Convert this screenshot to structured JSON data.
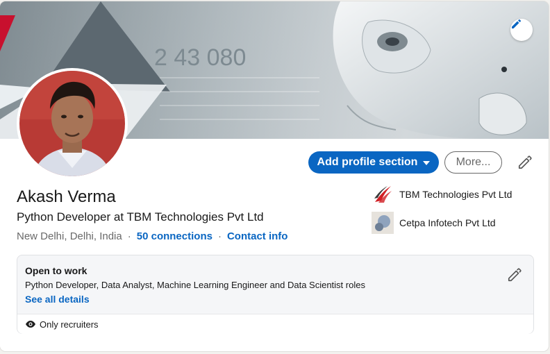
{
  "profile": {
    "name": "Akash Verma",
    "headline": "Python Developer at TBM Technologies Pvt Ltd",
    "location": "New Delhi, Delhi, India",
    "connections": "50 connections",
    "contact_info": "Contact info",
    "separator": "·"
  },
  "banner": {
    "overlay_text": "2 43 080",
    "edit_icon": "pencil-icon"
  },
  "actions": {
    "add_section_label": "Add profile section",
    "more_label": "More...",
    "edit_icon": "pencil-icon"
  },
  "companies": [
    {
      "name": "TBM Technologies Pvt Ltd",
      "logo": "tbm-logo"
    },
    {
      "name": "Cetpa Infotech Pvt Ltd",
      "logo": "cetpa-logo"
    }
  ],
  "open_to_work": {
    "title": "Open to work",
    "roles": "Python Developer, Data Analyst, Machine Learning Engineer and Data Scientist roles",
    "details_link": "See all details",
    "visibility": "Only recruiters",
    "visibility_icon": "eye-icon"
  },
  "colors": {
    "primary": "#0a66c2",
    "text": "#191919",
    "muted": "#666666"
  }
}
